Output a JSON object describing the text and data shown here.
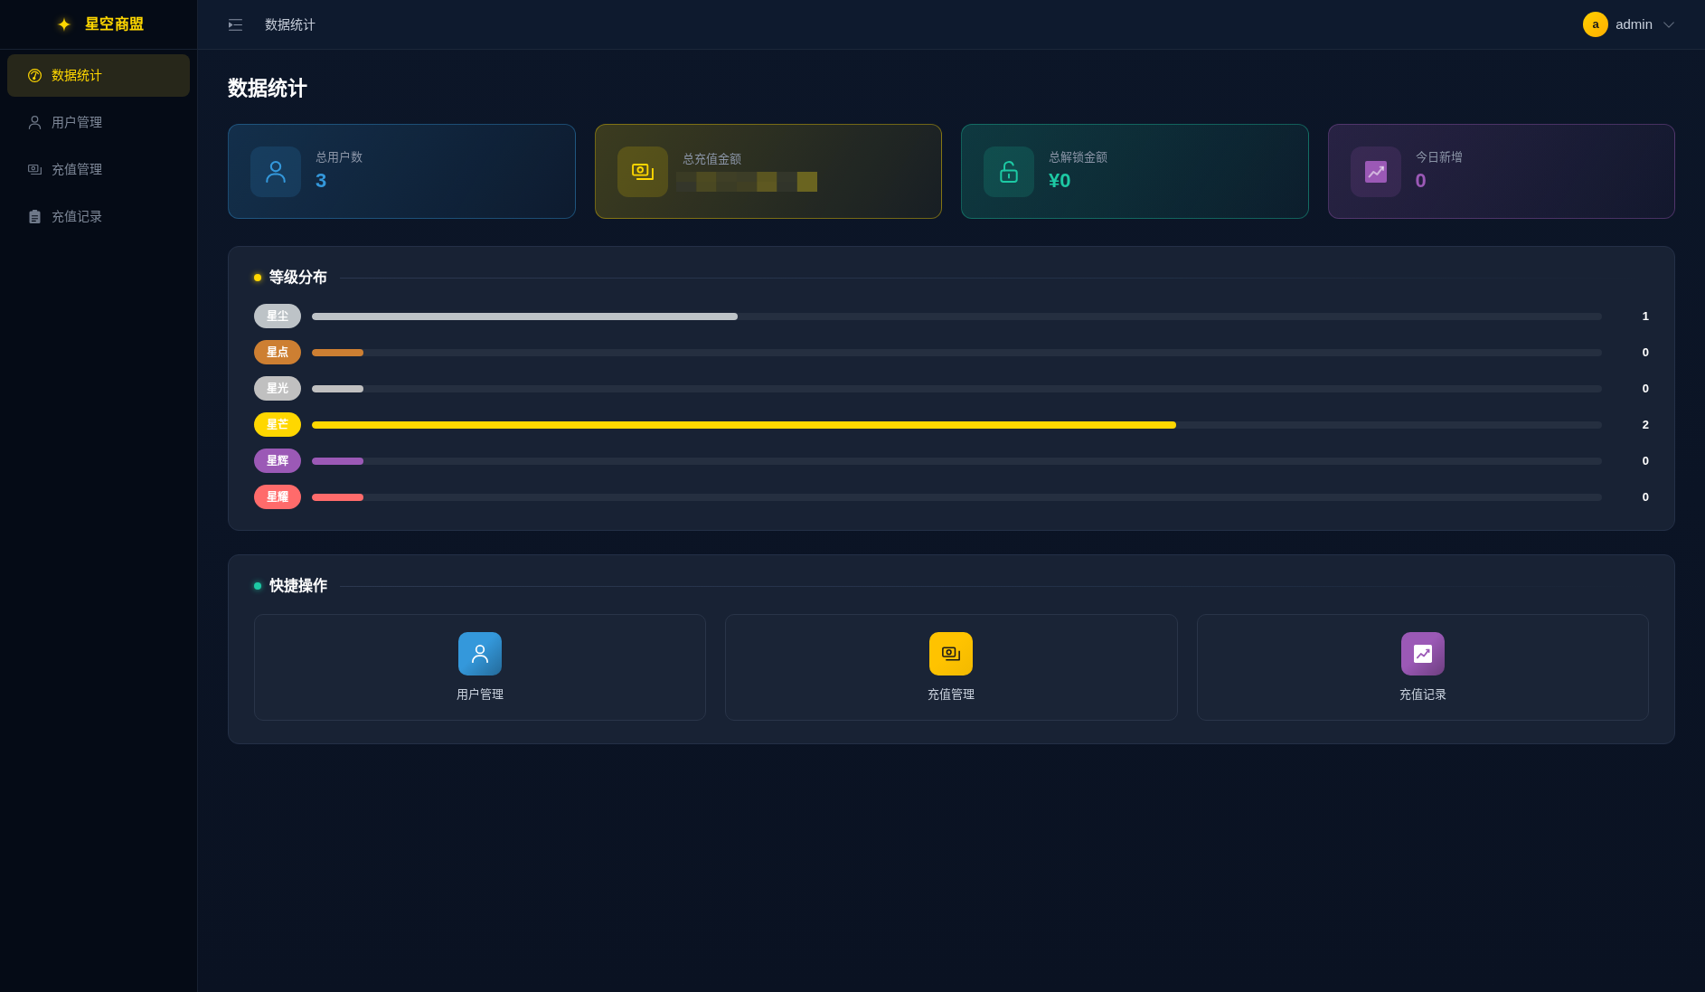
{
  "sidebar": {
    "brand": "星空商盟",
    "items": [
      {
        "label": "数据统计",
        "kind": "gauge",
        "selected": true
      },
      {
        "label": "用户管理",
        "kind": "user",
        "selected": false
      },
      {
        "label": "充值管理",
        "kind": "cash",
        "selected": false
      },
      {
        "label": "充值记录",
        "kind": "clipboard",
        "selected": false
      }
    ]
  },
  "header": {
    "breadcrumb": "数据统计",
    "user": {
      "avatar": "a",
      "name": "admin"
    }
  },
  "page_title": "数据统计",
  "stats": [
    {
      "label": "总用户数",
      "value": "3",
      "kind": "user",
      "color": "#3498db",
      "masked": false
    },
    {
      "label": "总充值金额",
      "kind": "cash",
      "color": "#ffd700",
      "masked": true
    },
    {
      "label": "总解锁金额",
      "value": "¥0",
      "kind": "unlock",
      "color": "#1dc9a4",
      "masked": false
    },
    {
      "label": "今日新增",
      "value": "0",
      "kind": "chart",
      "color": "#9b59b6",
      "masked": false
    }
  ],
  "level_distribution": {
    "title": "等级分布",
    "levels": [
      {
        "name": "星尘",
        "color": "#bdc3c7",
        "level": 0.33,
        "count": "1"
      },
      {
        "name": "星点",
        "color": "#cd7f32",
        "level": 0.04,
        "count": "0"
      },
      {
        "name": "星光",
        "color": "#c0c0c0",
        "level": 0.04,
        "count": "0"
      },
      {
        "name": "星芒",
        "color": "#ffd700",
        "level": 0.67,
        "count": "2"
      },
      {
        "name": "星辉",
        "color": "#9b59b6",
        "level": 0.04,
        "count": "0"
      },
      {
        "name": "星耀",
        "color": "#ff6b6b",
        "level": 0.04,
        "count": "0"
      }
    ]
  },
  "quick_actions": {
    "title": "快捷操作",
    "items": [
      {
        "label": "用户管理",
        "kind": "user",
        "color": "#3498db"
      },
      {
        "label": "充值管理",
        "kind": "cash",
        "color": "#ffc300"
      },
      {
        "label": "充值记录",
        "kind": "chart",
        "color": "#9b59b6"
      }
    ]
  }
}
